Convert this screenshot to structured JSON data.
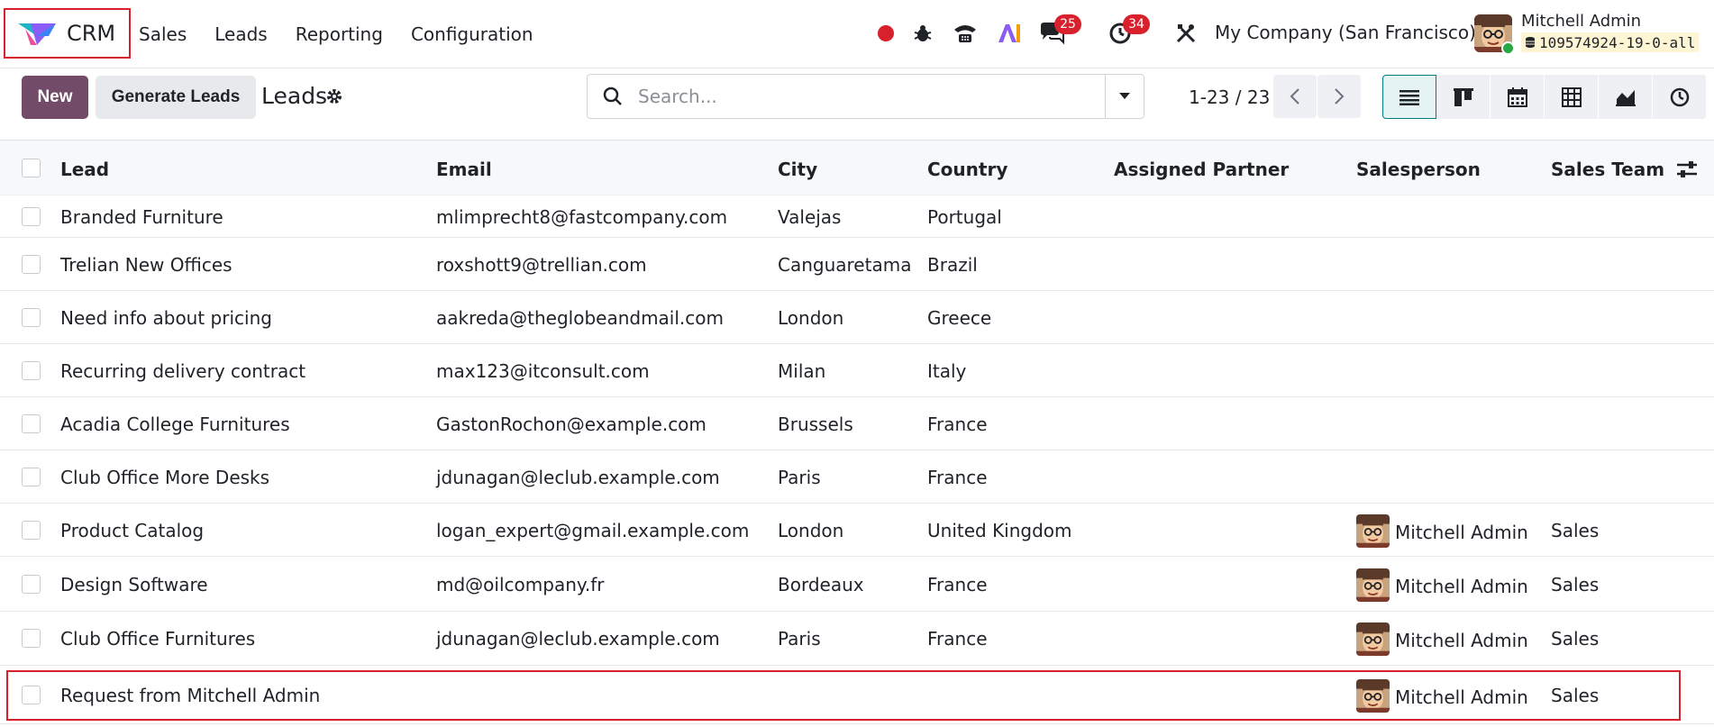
{
  "app": {
    "name": "CRM"
  },
  "menu": [
    "Sales",
    "Leads",
    "Reporting",
    "Configuration"
  ],
  "systray": {
    "discuss_count": "25",
    "activity_count": "34",
    "company": "My Company (San Francisco)",
    "user_name": "Mitchell Admin",
    "database": "109574924-19-0-all"
  },
  "control": {
    "new_label": "New",
    "generate_label": "Generate Leads",
    "title": "Leads",
    "search_placeholder": "Search...",
    "pager": "1-23 / 23"
  },
  "columns": {
    "lead": "Lead",
    "email": "Email",
    "city": "City",
    "country": "Country",
    "partner": "Assigned Partner",
    "salesperson": "Salesperson",
    "team": "Sales Team"
  },
  "rows": [
    {
      "lead": "Branded Furniture",
      "email": "mlimprecht8@fastcompany.com",
      "city": "Valejas",
      "country": "Portugal",
      "salesperson": "",
      "team": ""
    },
    {
      "lead": "Trelian New Offices",
      "email": "roxshott9@trellian.com",
      "city": "Canguaretama",
      "country": "Brazil",
      "salesperson": "",
      "team": ""
    },
    {
      "lead": "Need info about pricing",
      "email": "aakreda@theglobeandmail.com",
      "city": "London",
      "country": "Greece",
      "salesperson": "",
      "team": ""
    },
    {
      "lead": "Recurring delivery contract",
      "email": "max123@itconsult.com",
      "city": "Milan",
      "country": "Italy",
      "salesperson": "",
      "team": ""
    },
    {
      "lead": "Acadia College Furnitures",
      "email": "GastonRochon@example.com",
      "city": "Brussels",
      "country": "France",
      "salesperson": "",
      "team": ""
    },
    {
      "lead": "Club Office More Desks",
      "email": "jdunagan@leclub.example.com",
      "city": "Paris",
      "country": "France",
      "salesperson": "",
      "team": ""
    },
    {
      "lead": "Product Catalog",
      "email": "logan_expert@gmail.example.com",
      "city": "London",
      "country": "United Kingdom",
      "salesperson": "Mitchell Admin",
      "team": "Sales"
    },
    {
      "lead": "Design Software",
      "email": "md@oilcompany.fr",
      "city": "Bordeaux",
      "country": "France",
      "salesperson": "Mitchell Admin",
      "team": "Sales"
    },
    {
      "lead": "Club Office Furnitures",
      "email": "jdunagan@leclub.example.com",
      "city": "Paris",
      "country": "France",
      "salesperson": "Mitchell Admin",
      "team": "Sales"
    },
    {
      "lead": "Request from Mitchell Admin",
      "email": "",
      "city": "",
      "country": "",
      "salesperson": "Mitchell Admin",
      "team": "Sales"
    }
  ],
  "colors": {
    "primary": "#714b67",
    "accent": "#017e84",
    "badge": "#d8212c"
  },
  "icons": [
    "crm-logo-icon",
    "record-icon",
    "bug-icon",
    "phone-icon",
    "ai-icon",
    "chat-icon",
    "clock-icon",
    "tools-icon",
    "search-icon",
    "caret-down-icon",
    "gear-icon",
    "list-view-icon",
    "kanban-view-icon",
    "calendar-view-icon",
    "pivot-view-icon",
    "graph-view-icon",
    "activity-view-icon",
    "optional-columns-icon"
  ]
}
